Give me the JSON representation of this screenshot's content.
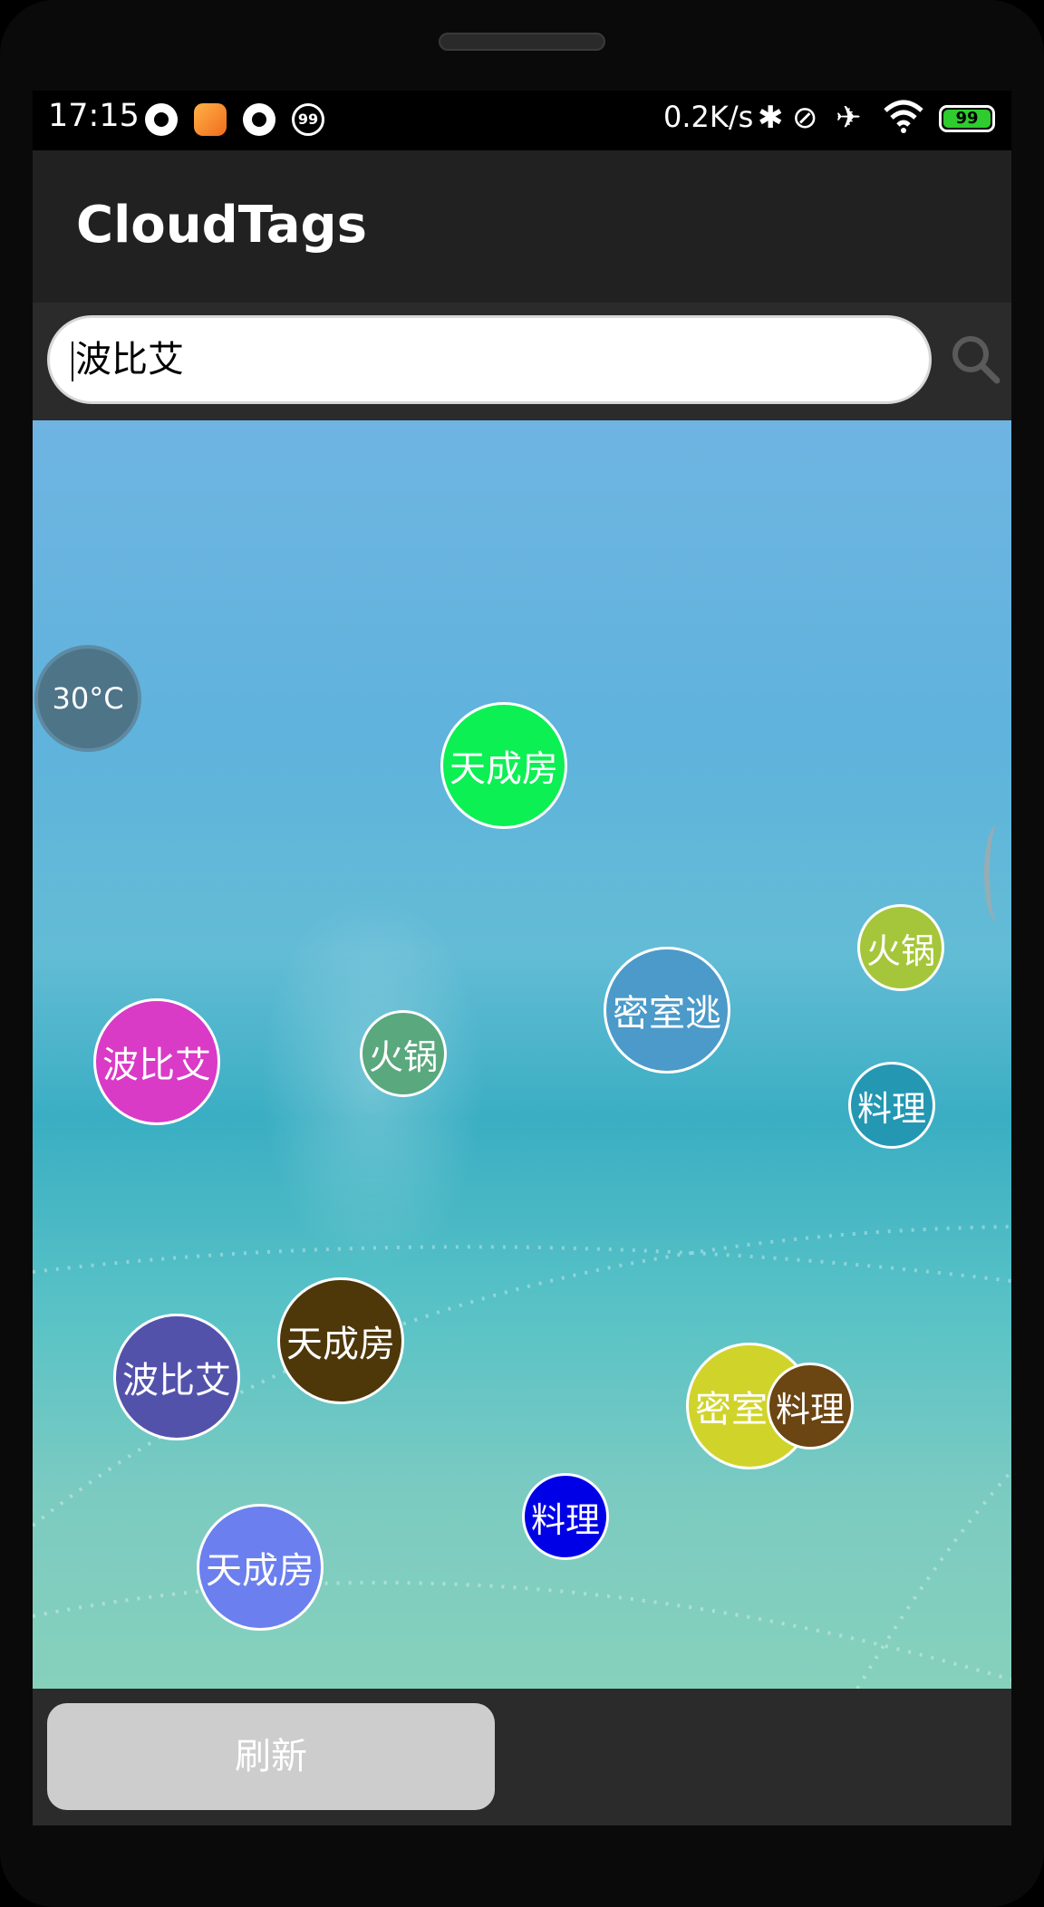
{
  "status_bar": {
    "time": "17:15",
    "net_speed": "0.2K/s",
    "battery_level": "99",
    "notification_badge": "99"
  },
  "app_bar": {
    "title": "CloudTags"
  },
  "search": {
    "value": "波比艾",
    "icon": "search-icon"
  },
  "cloud": {
    "weather": "30°C",
    "tags": [
      {
        "label": "天成房",
        "color": "#0cf054"
      },
      {
        "label": "火锅",
        "color": "#a5c63a"
      },
      {
        "label": "密室逃",
        "color": "#4b9ac9"
      },
      {
        "label": "火锅",
        "color": "#5aa87e"
      },
      {
        "label": "波比艾",
        "color": "#d93ac6"
      },
      {
        "label": "料理",
        "color": "#2497b2"
      },
      {
        "label": "天成房",
        "color": "#4e3709"
      },
      {
        "label": "密室逃",
        "color": "#d0d42a"
      },
      {
        "label": "波比艾",
        "color": "#5352ab"
      },
      {
        "label": "料理",
        "color": "#6b4512"
      },
      {
        "label": "料理",
        "color": "#0000e6"
      },
      {
        "label": "天成房",
        "color": "#6b7fee"
      }
    ]
  },
  "bottom_bar": {
    "refresh_label": "刷新"
  }
}
